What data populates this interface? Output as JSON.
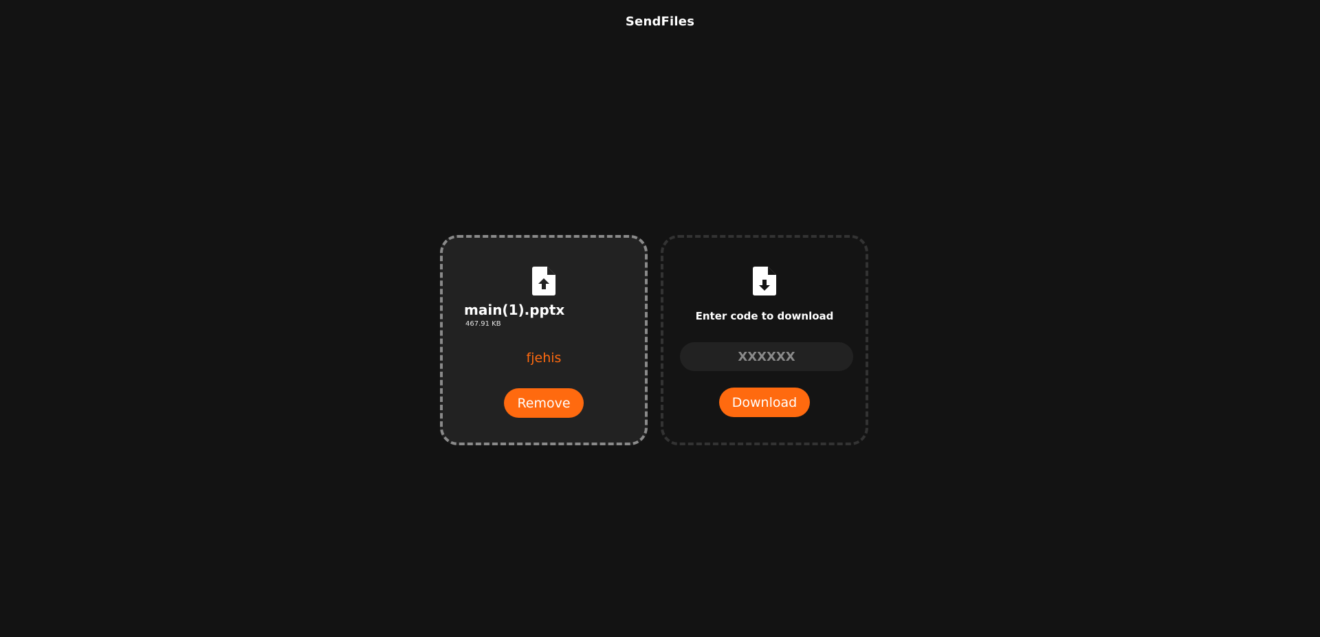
{
  "app": {
    "title": "SendFiles"
  },
  "upload_card": {
    "icon": "file-upload-icon",
    "file_name": "main(1).pptx",
    "file_size": "467.91 KB",
    "share_code": "fjehis",
    "remove_label": "Remove"
  },
  "download_card": {
    "icon": "file-download-icon",
    "heading": "Enter code to download",
    "code_input_value": "",
    "code_input_placeholder": "XXXXXX",
    "download_label": "Download"
  },
  "colors": {
    "background": "#131313",
    "accent": "#ff6a0f",
    "card_active": "#222222",
    "card_idle": "#141414"
  }
}
